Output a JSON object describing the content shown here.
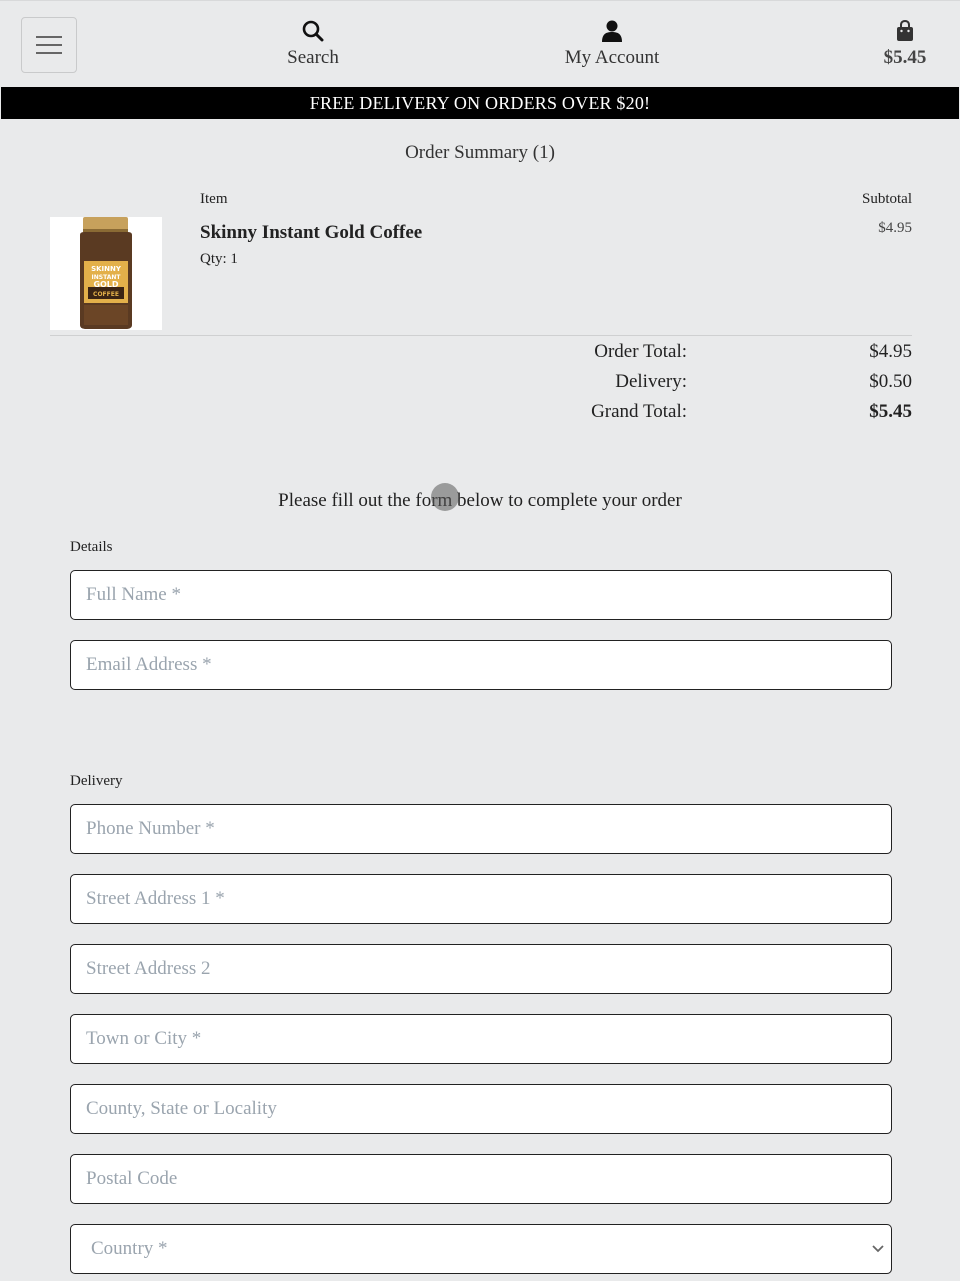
{
  "header": {
    "search_label": "Search",
    "account_label": "My Account",
    "cart_total": "$5.45"
  },
  "promo": "FREE DELIVERY ON ORDERS OVER $20!",
  "summary": {
    "title": "Order Summary (1)",
    "col_item": "Item",
    "col_subtotal": "Subtotal",
    "item": {
      "name": "Skinny Instant Gold Coffee",
      "qty": "Qty: 1",
      "subtotal": "$4.95",
      "jar_text": [
        "SKINNY",
        "INSTANT",
        "GOLD",
        "COFFEE"
      ]
    },
    "order_total_label": "Order Total:",
    "order_total": "$4.95",
    "delivery_label": "Delivery:",
    "delivery": "$0.50",
    "grand_total_label": "Grand Total:",
    "grand_total": "$5.45"
  },
  "form": {
    "intro": "Please fill out the form below to complete your order",
    "details_label": "Details",
    "full_name_ph": "Full Name *",
    "email_ph": "Email Address *",
    "delivery_label": "Delivery",
    "phone_ph": "Phone Number *",
    "street1_ph": "Street Address 1 *",
    "street2_ph": "Street Address 2",
    "town_ph": "Town or City *",
    "county_ph": "County, State or Locality",
    "postal_ph": "Postal Code",
    "country_ph": "Country *"
  }
}
